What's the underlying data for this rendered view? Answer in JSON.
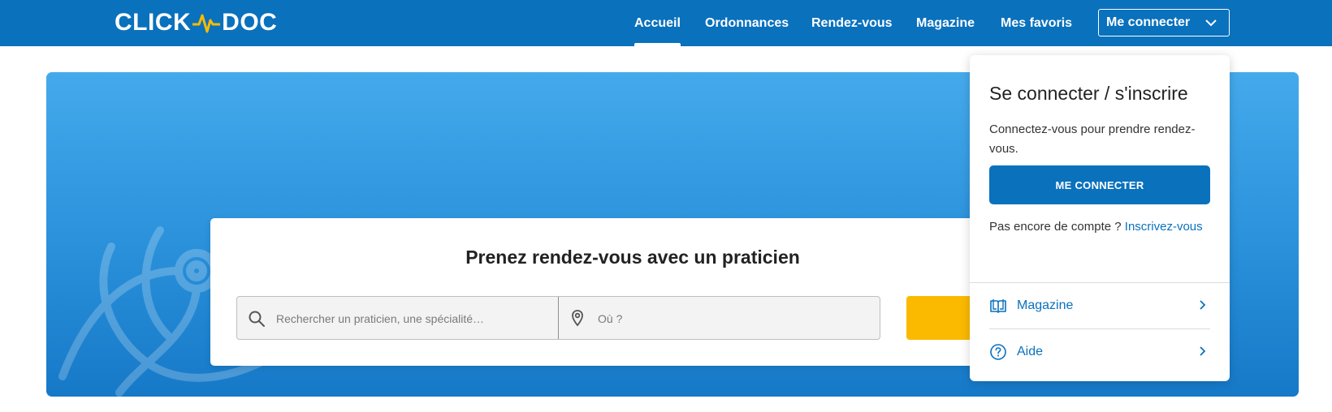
{
  "header": {
    "logo_left": "CLICK",
    "logo_right": "DOC",
    "nav": [
      {
        "label": "Accueil",
        "active": true
      },
      {
        "label": "Ordonnances",
        "active": false
      },
      {
        "label": "Rendez-vous",
        "active": false
      },
      {
        "label": "Magazine",
        "active": false
      },
      {
        "label": "Mes favoris",
        "active": false
      }
    ],
    "login_label": "Me connecter"
  },
  "search": {
    "title": "Prenez rendez-vous avec un praticien",
    "what_placeholder": "Rechercher un praticien, une spécialité…",
    "where_placeholder": "Où ?"
  },
  "dropdown": {
    "title": "Se connecter / s'inscrire",
    "text": "Connectez-vous pour prendre rendez-vous.",
    "button": "ME CONNECTER",
    "signup_prefix": "Pas encore de compte ?",
    "signup_link": "Inscrivez-vous",
    "links": [
      {
        "label": "Magazine",
        "icon": "book-open-icon"
      },
      {
        "label": "Aide",
        "icon": "help-circle-icon"
      }
    ]
  },
  "colors": {
    "brand_blue": "#0a71bd",
    "accent_yellow": "#fbba00",
    "logo_pulse": "#fbba00"
  }
}
